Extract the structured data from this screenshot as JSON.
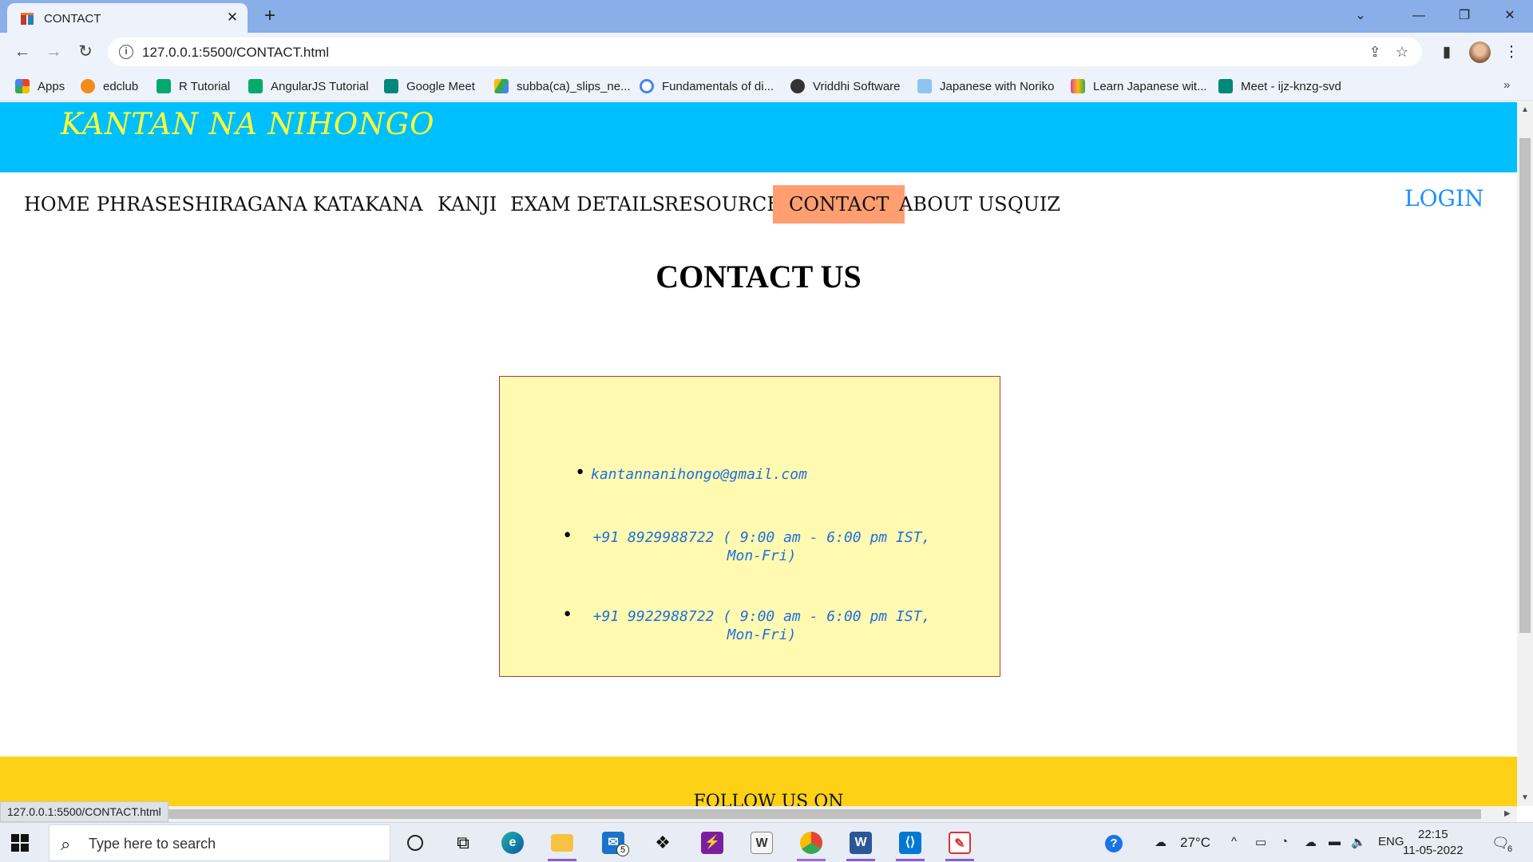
{
  "browser": {
    "tab_title": "CONTACT",
    "url": "127.0.0.1:5500/CONTACT.html",
    "status_url": "127.0.0.1:5500/CONTACT.html"
  },
  "bookmarks": [
    {
      "label": "Apps",
      "icon": "apps-grid-icon",
      "color": "#e94235"
    },
    {
      "label": "edclub",
      "icon": "edclub-icon",
      "color": "#f28b1c"
    },
    {
      "label": "R Tutorial",
      "icon": "w3schools-icon",
      "color": "#04aa6d"
    },
    {
      "label": "AngularJS Tutorial",
      "icon": "w3schools-icon",
      "color": "#04aa6d"
    },
    {
      "label": "Google Meet",
      "icon": "google-meet-icon",
      "color": "#00897b"
    },
    {
      "label": "subba(ca)_slips_ne...",
      "icon": "google-drive-icon",
      "color": "#fbbc04"
    },
    {
      "label": "Fundamentals of di...",
      "icon": "google-icon",
      "color": "#4285f4"
    },
    {
      "label": "Vriddhi Software",
      "icon": "globe-icon",
      "color": "#333333"
    },
    {
      "label": "Japanese with Noriko",
      "icon": "site-icon",
      "color": "#8ec5f0"
    },
    {
      "label": "Learn Japanese wit...",
      "icon": "podcast-icon",
      "color": "#e040a0"
    },
    {
      "label": "Meet - ijz-knzg-svd",
      "icon": "google-meet-icon",
      "color": "#00897b"
    }
  ],
  "site": {
    "brand": "KANTAN NA NIHONGO",
    "nav": [
      {
        "label": "HOME"
      },
      {
        "label": "PHRASES"
      },
      {
        "label": "HIRAGANA"
      },
      {
        "label": "KATAKANA"
      },
      {
        "label": "KANJI"
      },
      {
        "label": "EXAM DETAILS"
      },
      {
        "label": "RESOURCES"
      },
      {
        "label": "CONTACT"
      },
      {
        "label": "ABOUT US"
      },
      {
        "label": "QUIZ"
      }
    ],
    "active_nav": "CONTACT",
    "login": "LOGIN",
    "page_title": "CONTACT US",
    "contacts": [
      {
        "text": "kantannanihongo@gmail.com"
      },
      {
        "text": "+91 8929988722 ( 9:00 am - 6:00 pm IST, Mon-Fri)"
      },
      {
        "text": "+91 9922988722 ( 9:00 am - 6:00 pm IST, Mon-Fri)"
      }
    ],
    "footer_heading": "FOLLOW US ON",
    "colors": {
      "header_bg": "#00bfff",
      "brand_text": "#ffff33",
      "active_nav_bg": "#ff9e70",
      "login_text": "#1e90ff",
      "contact_box_bg": "#fffab0",
      "contact_box_border": "#b23a3a",
      "contact_text": "#1e6fe0",
      "footer_bg": "#fcd116"
    }
  },
  "taskbar": {
    "search_placeholder": "Type here to search",
    "mail_badge": "5",
    "weather": "27°C",
    "language": "ENG",
    "time": "22:15",
    "date": "11-05-2022",
    "notification_count": "6"
  }
}
